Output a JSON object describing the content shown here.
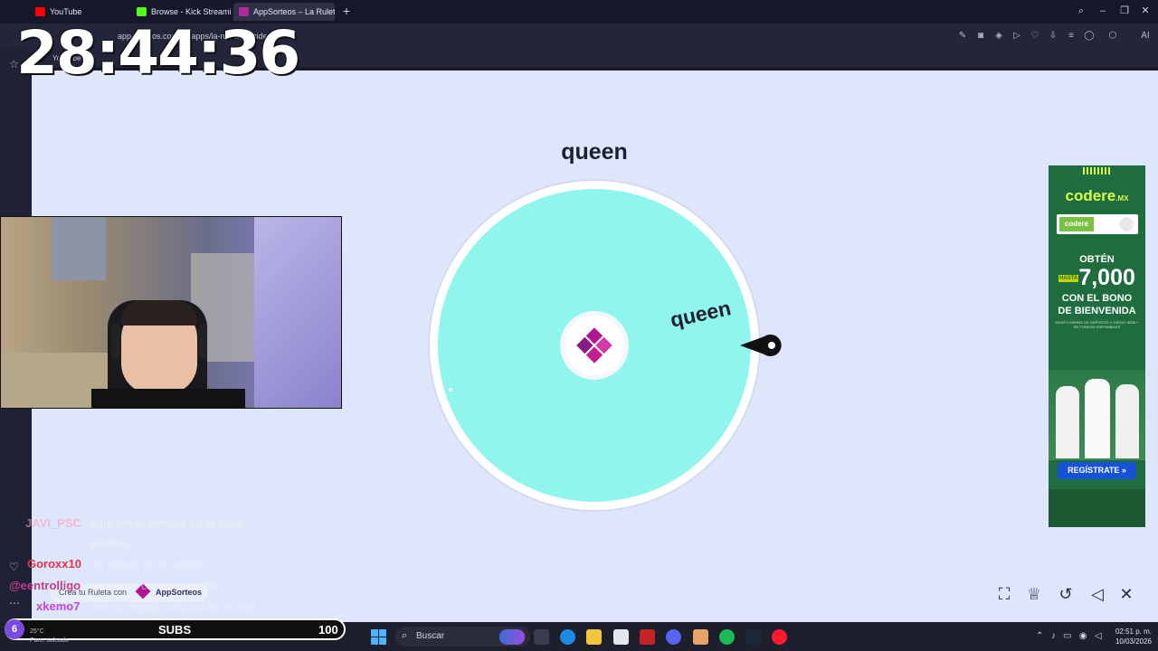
{
  "browser": {
    "tabs": [
      {
        "label": "YouTube",
        "color": "#ff0000"
      },
      {
        "label": "Browse - Kick Streaming",
        "color": "#53fc18"
      },
      {
        "label": "AppSorteos – La Ruleta de",
        "color": "#b02aa0",
        "active": true
      }
    ],
    "url": "app-sorteos.com/es/apps/la-ruleta-decide",
    "bookmark_youtube": "YouTube"
  },
  "overlay": {
    "timer": "28:44:36",
    "subs_badge": "6",
    "subs_label": "SUBS",
    "subs_count": "100",
    "weather": {
      "temp": "25°C",
      "desc": "Parc. soleado"
    }
  },
  "wheel": {
    "title": "queen",
    "segment_label": "queen",
    "segment_color": "#90f5ec",
    "rim_color": "#ffffff",
    "made_with": "Crea tu Ruleta con",
    "brand": "AppSorteos"
  },
  "ad": {
    "brand": "codere",
    "brand_suffix": ".MX",
    "badge_logo": "codere",
    "headline": "OBTÉN",
    "hasta": "HASTA",
    "amount": "7,000",
    "bono_line1": "CON EL BONO",
    "bono_line2": "DE BIENVENIDA",
    "fine_print": "MONTO MÍNIMO DE DEPÓSITO Y JUEGO: $200 + EN FONDOS DISPONIBLES",
    "cta": "REGÍSTRATE »"
  },
  "chat": [
    {
      "user": "JAVI_PSC",
      "color": "#ff9fb0",
      "message": "aqui tengo comida en la casa"
    },
    {
      "user": "",
      "color": "#ffffff",
      "message": "perritas"
    },
    {
      "user": "Goroxx10",
      "color": "#e8324a",
      "message": "de donde es la queen"
    },
    {
      "user": "@eentrolligo",
      "color": "#c33c8a",
      "message": "quiero mi carrito de shein"
    },
    {
      "user": "xkemo7",
      "color": "#c744d8",
      "message": "star: yo regalo otra pizza al chat"
    }
  ],
  "taskbar": {
    "search": "Buscar",
    "time": "02:51 p. m.",
    "date": "10/03/2026"
  }
}
